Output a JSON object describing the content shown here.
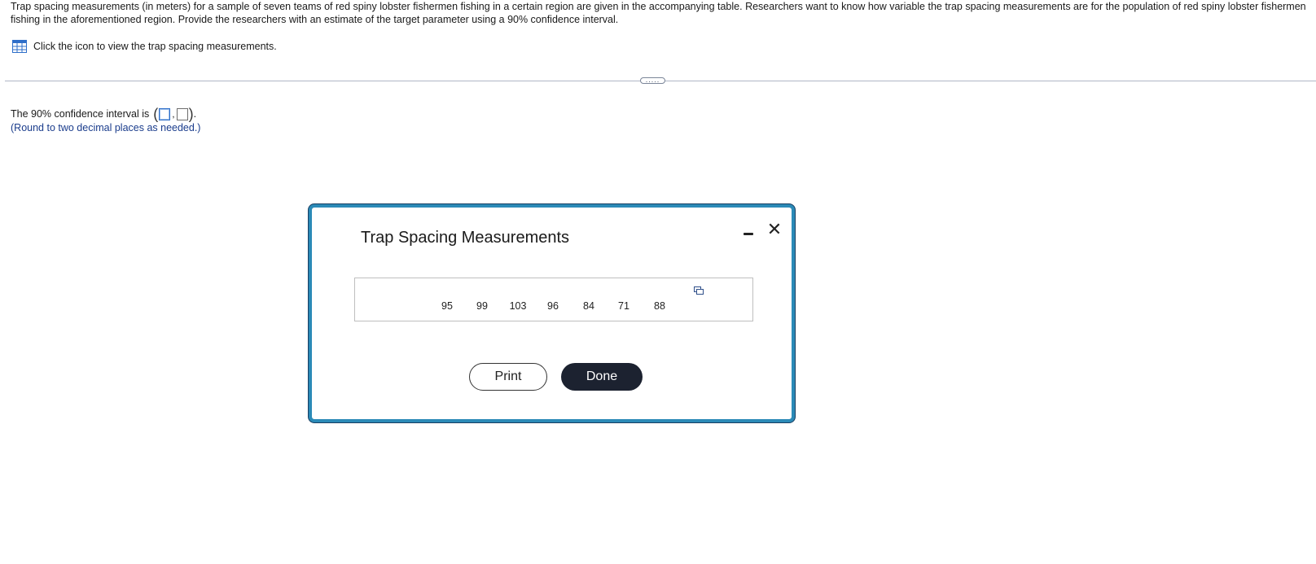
{
  "problem": {
    "text": "Trap spacing measurements (in meters) for a sample of seven teams of red spiny lobster fishermen fishing in a certain region are given in the accompanying table. Researchers want to know how variable the trap spacing measurements are for the population of red spiny lobster fishermen fishing in the aforementioned region. Provide the researchers with an estimate of the target parameter using a 90% confidence interval.",
    "icon_link_text": "Click the icon to view the trap spacing measurements."
  },
  "divider": {
    "more_label": "....."
  },
  "answer": {
    "prompt": "The 90% confidence interval is",
    "open_paren": "(",
    "separator": ",",
    "close_paren": ")",
    "end_period": ".",
    "lower_value": "",
    "upper_value": "",
    "note": "(Round to two decimal places as needed.)"
  },
  "dialog": {
    "title": "Trap Spacing Measurements",
    "measurements": [
      "95",
      "99",
      "103",
      "96",
      "84",
      "71",
      "88"
    ],
    "print_label": "Print",
    "done_label": "Done",
    "close_glyph": "✕"
  },
  "colors": {
    "dialog_border": "#2b8ab7",
    "done_button": "#1c2230",
    "note_text": "#1a3c8c",
    "table_icon": "#2f6fc9"
  }
}
